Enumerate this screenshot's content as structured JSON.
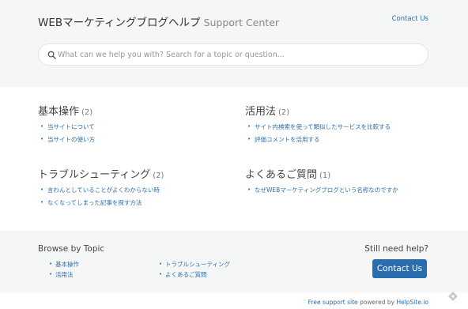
{
  "header": {
    "site_title": "WEBマーケティングブログヘルプ",
    "site_subtitle": "Support Center",
    "contact_link": "Contact Us"
  },
  "search": {
    "placeholder": "What can we help you with? Search for a topic or question...",
    "icon": "search-icon"
  },
  "categories": [
    {
      "title": "基本操作",
      "count": "(2)",
      "articles": [
        "当サイトについて",
        "当サイトの使い方"
      ]
    },
    {
      "title": "活用法",
      "count": "(2)",
      "articles": [
        "サイト内検索を使って類似したサービスを比較する",
        "評価コメントを活用する"
      ]
    },
    {
      "title": "トラブルシューティング",
      "count": "(2)",
      "articles": [
        "言わんとしていることがよくわからない時",
        "なくなってしまった記事を探す方法"
      ]
    },
    {
      "title": "よくあるご質問",
      "count": "(1)",
      "articles": [
        "なぜWEBマーケティングブログという名称なのですか"
      ]
    }
  ],
  "footer": {
    "browse_title": "Browse by Topic",
    "topics_col1": [
      "基本操作",
      "活用法"
    ],
    "topics_col2": [
      "トラブルシューティング",
      "よくあるご質問"
    ],
    "still_need_help": "Still need help?",
    "contact_button": "Contact Us"
  },
  "powered_by": {
    "free_link": "Free support site",
    "text": "powered by",
    "helpsite_link": "HelpSite.io"
  },
  "colors": {
    "accent": "#2a6eb0",
    "header_bg": "#f5f6f6",
    "footer_bg": "#f5f6f6"
  }
}
